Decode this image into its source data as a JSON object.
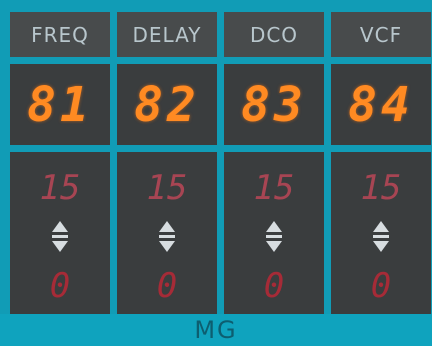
{
  "columns": [
    {
      "header": "FREQ",
      "display": "81",
      "max": "15",
      "min": "0"
    },
    {
      "header": "DELAY",
      "display": "82",
      "max": "15",
      "min": "0"
    },
    {
      "header": "DCO",
      "display": "83",
      "max": "15",
      "min": "0"
    },
    {
      "header": "VCF",
      "display": "84",
      "max": "15",
      "min": "0"
    }
  ],
  "footer": {
    "label": "MG"
  },
  "icons": {
    "increment": "triangle-up-icon",
    "decrement": "triangle-down-icon"
  },
  "colors": {
    "panel": "#119cb6",
    "display_text": "#ff8a22",
    "range_text": "#a74553",
    "header_text": "#b8c6cc"
  }
}
